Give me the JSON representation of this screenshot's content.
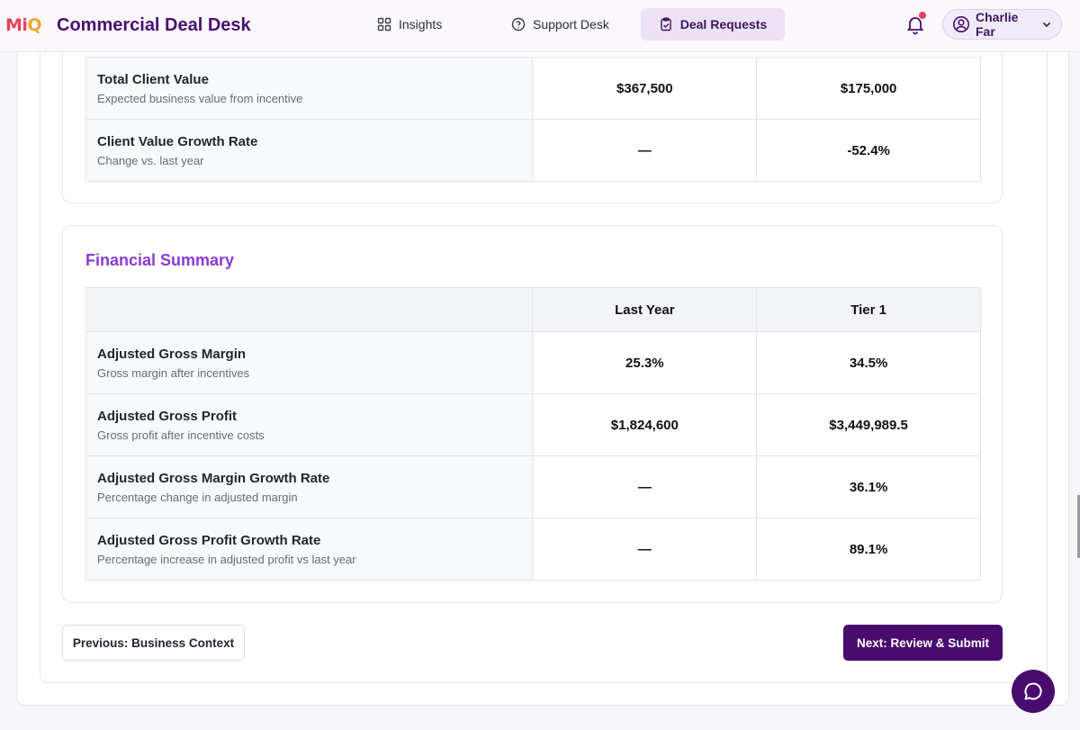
{
  "header": {
    "logo_part1": "Mi",
    "logo_part2": "Q",
    "app_title": "Commercial Deal Desk",
    "nav": {
      "insights": "Insights",
      "support": "Support Desk",
      "deals": "Deal Requests"
    },
    "user_name": "Charlie Far",
    "icons": {
      "insights": "grid-icon",
      "support": "help-circle-icon",
      "deals": "clipboard-icon",
      "notifications": "bell-icon",
      "user": "user-circle-icon",
      "menu": "chevron-down-icon"
    }
  },
  "client_value_table": {
    "rows": [
      {
        "title": "Total Client Value",
        "subtitle": "Expected business value from incentive",
        "last_year": "$367,500",
        "tier1": "$175,000"
      },
      {
        "title": "Client Value Growth Rate",
        "subtitle": "Change vs. last year",
        "last_year": "—",
        "tier1": "-52.4%"
      }
    ]
  },
  "financial_summary": {
    "title": "Financial Summary",
    "columns": [
      "",
      "Last Year",
      "Tier 1"
    ],
    "rows": [
      {
        "title": "Adjusted Gross Margin",
        "subtitle": "Gross margin after incentives",
        "last_year": "25.3%",
        "tier1": "34.5%"
      },
      {
        "title": "Adjusted Gross Profit",
        "subtitle": "Gross profit after incentive costs",
        "last_year": "$1,824,600",
        "tier1": "$3,449,989.5"
      },
      {
        "title": "Adjusted Gross Margin Growth Rate",
        "subtitle": "Percentage change in adjusted margin",
        "last_year": "—",
        "tier1": "36.1%"
      },
      {
        "title": "Adjusted Gross Profit Growth Rate",
        "subtitle": "Percentage increase in adjusted profit vs last year",
        "last_year": "—",
        "tier1": "89.1%"
      }
    ]
  },
  "footer": {
    "prev_label": "Previous: Business Context",
    "next_label": "Next: Review & Submit"
  },
  "colors": {
    "brand": "#4a0b6f",
    "accent": "#8a3bd6",
    "negative": "#d63a2c",
    "positive": "#2e9b4f",
    "notification_dot": "#e8425a"
  }
}
